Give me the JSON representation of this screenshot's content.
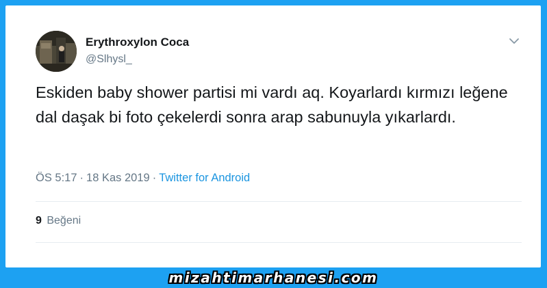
{
  "tweet": {
    "author": {
      "display_name": "Erythroxylon Coca",
      "handle": "@Slhysl_"
    },
    "text": "Eskiden baby shower partisi mi vardı aq. Koyarlardı kırmızı leğene dal daşak bi foto çekelerdi sonra arap sabunuyla yıkarlardı.",
    "time": "ÖS 5:17",
    "separator": "·",
    "date": "18 Kas 2019",
    "source": "Twitter for Android",
    "likes_count": "9",
    "likes_label": "Beğeni"
  },
  "watermark": {
    "text": "mizahtimarhanesi.com"
  },
  "icons": {
    "menu": "chevron-down-icon",
    "avatar": "avatar-photo"
  },
  "colors": {
    "background": "#1da1f2",
    "link": "#1b95e0",
    "secondary_text": "#657786",
    "primary_text": "#14171a"
  }
}
